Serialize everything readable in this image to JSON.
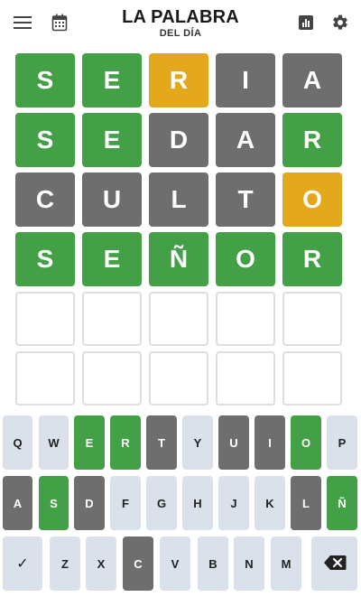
{
  "header": {
    "title": "LA PALABRA",
    "subtitle": "DEL DÍA",
    "icons": [
      "menu-icon",
      "calendar-icon",
      "stats-icon",
      "gear-icon"
    ]
  },
  "colors": {
    "correct": "#43a047",
    "present": "#e4a81d",
    "absent": "#6e6e6e",
    "key_default": "#dbe1ea",
    "empty_border": "#dedede"
  },
  "board": [
    [
      {
        "l": "S",
        "s": "correct"
      },
      {
        "l": "E",
        "s": "correct"
      },
      {
        "l": "R",
        "s": "present"
      },
      {
        "l": "I",
        "s": "absent"
      },
      {
        "l": "A",
        "s": "absent"
      }
    ],
    [
      {
        "l": "S",
        "s": "correct"
      },
      {
        "l": "E",
        "s": "correct"
      },
      {
        "l": "D",
        "s": "absent"
      },
      {
        "l": "A",
        "s": "absent"
      },
      {
        "l": "R",
        "s": "correct"
      }
    ],
    [
      {
        "l": "C",
        "s": "absent"
      },
      {
        "l": "U",
        "s": "absent"
      },
      {
        "l": "L",
        "s": "absent"
      },
      {
        "l": "T",
        "s": "absent"
      },
      {
        "l": "O",
        "s": "present"
      }
    ],
    [
      {
        "l": "S",
        "s": "correct"
      },
      {
        "l": "E",
        "s": "correct"
      },
      {
        "l": "Ñ",
        "s": "correct"
      },
      {
        "l": "O",
        "s": "correct"
      },
      {
        "l": "R",
        "s": "correct"
      }
    ],
    [
      {
        "l": "",
        "s": "empty"
      },
      {
        "l": "",
        "s": "empty"
      },
      {
        "l": "",
        "s": "empty"
      },
      {
        "l": "",
        "s": "empty"
      },
      {
        "l": "",
        "s": "empty"
      }
    ],
    [
      {
        "l": "",
        "s": "empty"
      },
      {
        "l": "",
        "s": "empty"
      },
      {
        "l": "",
        "s": "empty"
      },
      {
        "l": "",
        "s": "empty"
      },
      {
        "l": "",
        "s": "empty"
      }
    ]
  ],
  "keyboard": [
    [
      {
        "k": "Q",
        "s": ""
      },
      {
        "k": "W",
        "s": ""
      },
      {
        "k": "E",
        "s": "correct"
      },
      {
        "k": "R",
        "s": "correct"
      },
      {
        "k": "T",
        "s": "absent"
      },
      {
        "k": "Y",
        "s": ""
      },
      {
        "k": "U",
        "s": "absent"
      },
      {
        "k": "I",
        "s": "absent"
      },
      {
        "k": "O",
        "s": "correct"
      },
      {
        "k": "P",
        "s": ""
      }
    ],
    [
      {
        "k": "A",
        "s": "absent"
      },
      {
        "k": "S",
        "s": "correct"
      },
      {
        "k": "D",
        "s": "absent"
      },
      {
        "k": "F",
        "s": ""
      },
      {
        "k": "G",
        "s": ""
      },
      {
        "k": "H",
        "s": ""
      },
      {
        "k": "J",
        "s": ""
      },
      {
        "k": "K",
        "s": ""
      },
      {
        "k": "L",
        "s": "absent"
      },
      {
        "k": "Ñ",
        "s": "correct"
      }
    ],
    [
      {
        "k": "✓",
        "s": "",
        "name": "enter-key",
        "icon": "checkmark-icon"
      },
      {
        "k": "Z",
        "s": ""
      },
      {
        "k": "X",
        "s": ""
      },
      {
        "k": "C",
        "s": "absent"
      },
      {
        "k": "V",
        "s": ""
      },
      {
        "k": "B",
        "s": ""
      },
      {
        "k": "N",
        "s": ""
      },
      {
        "k": "M",
        "s": ""
      },
      {
        "k": "",
        "s": "",
        "name": "backspace-key",
        "icon": "backspace-icon"
      }
    ]
  ]
}
